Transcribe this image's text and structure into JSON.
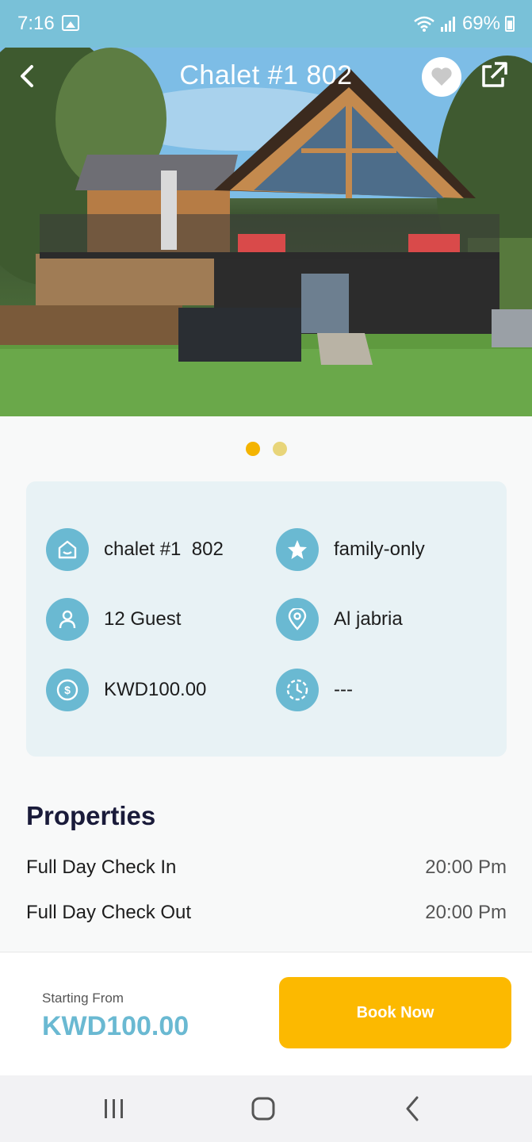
{
  "status_bar": {
    "time": "7:16",
    "battery": "69%"
  },
  "header": {
    "title": "Chalet #1  802"
  },
  "carousel": {
    "active_color": "#f4b400",
    "inactive_color": "#e8d57a"
  },
  "info": {
    "name": "chalet #1  802",
    "category": "family-only",
    "guests": "12 Guest",
    "location": "Al jabria",
    "price": "KWD100.00",
    "duration": "---"
  },
  "properties": {
    "title": "Properties",
    "rows": [
      {
        "label": "Full Day Check In",
        "value": "20:00 Pm"
      },
      {
        "label": "Full Day Check Out",
        "value": "20:00 Pm"
      }
    ]
  },
  "footer": {
    "starting_label": "Starting From",
    "starting_price": "KWD100.00",
    "book_label": "Book Now"
  },
  "colors": {
    "accent": "#6ab9d2",
    "cta": "#fcb900",
    "status_bar": "#79c1d8"
  }
}
